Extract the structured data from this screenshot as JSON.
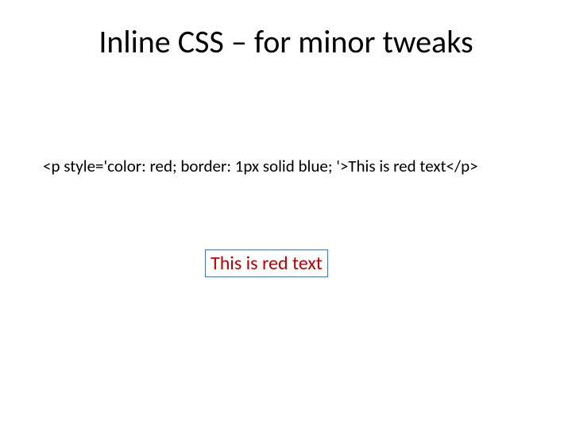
{
  "slide": {
    "title": "Inline CSS – for minor tweaks",
    "code_example": "<p style='color: red; border: 1px solid blue; '>This is red text</p>",
    "rendered_text": "This is red text"
  }
}
